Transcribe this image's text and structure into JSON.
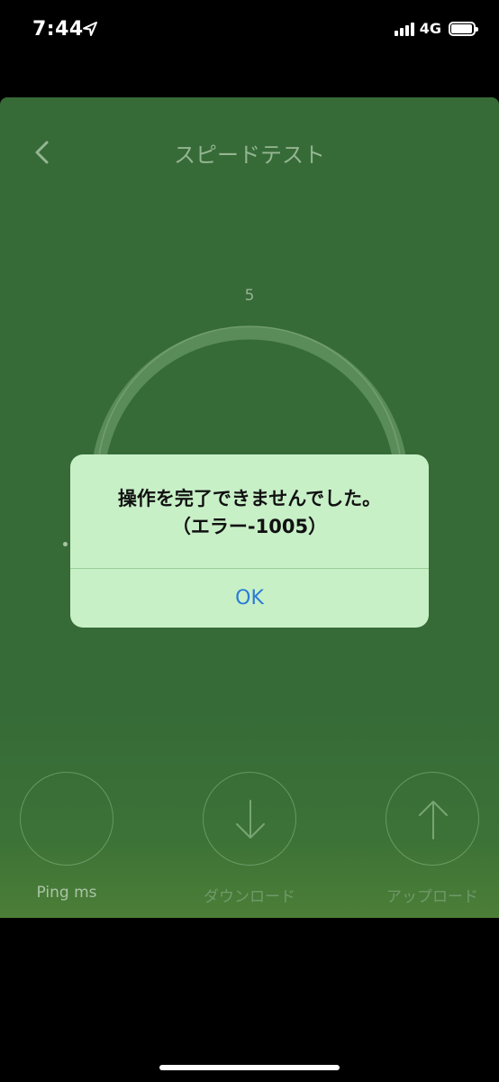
{
  "status_bar": {
    "time": "7:44",
    "network": "4G",
    "icons": [
      "location-arrow-icon",
      "signal-bars-icon",
      "battery-icon"
    ]
  },
  "nav": {
    "title": "スピードテスト",
    "back_icon": "chevron-left-icon"
  },
  "gauge": {
    "tick_label": "5"
  },
  "metrics": [
    {
      "label": "Ping ms",
      "icon": ""
    },
    {
      "label": "ダウンロード",
      "icon": "arrow-down-icon"
    },
    {
      "label": "アップロード",
      "icon": "arrow-up-icon"
    }
  ],
  "alert": {
    "message_line1": "操作を完了できませんでした。",
    "message_line2": "（エラー-1005）",
    "ok_label": "OK"
  },
  "colors": {
    "app_background": "#366b37",
    "alert_background": "#c8f0c7",
    "alert_button_text": "#2b7bd6"
  }
}
